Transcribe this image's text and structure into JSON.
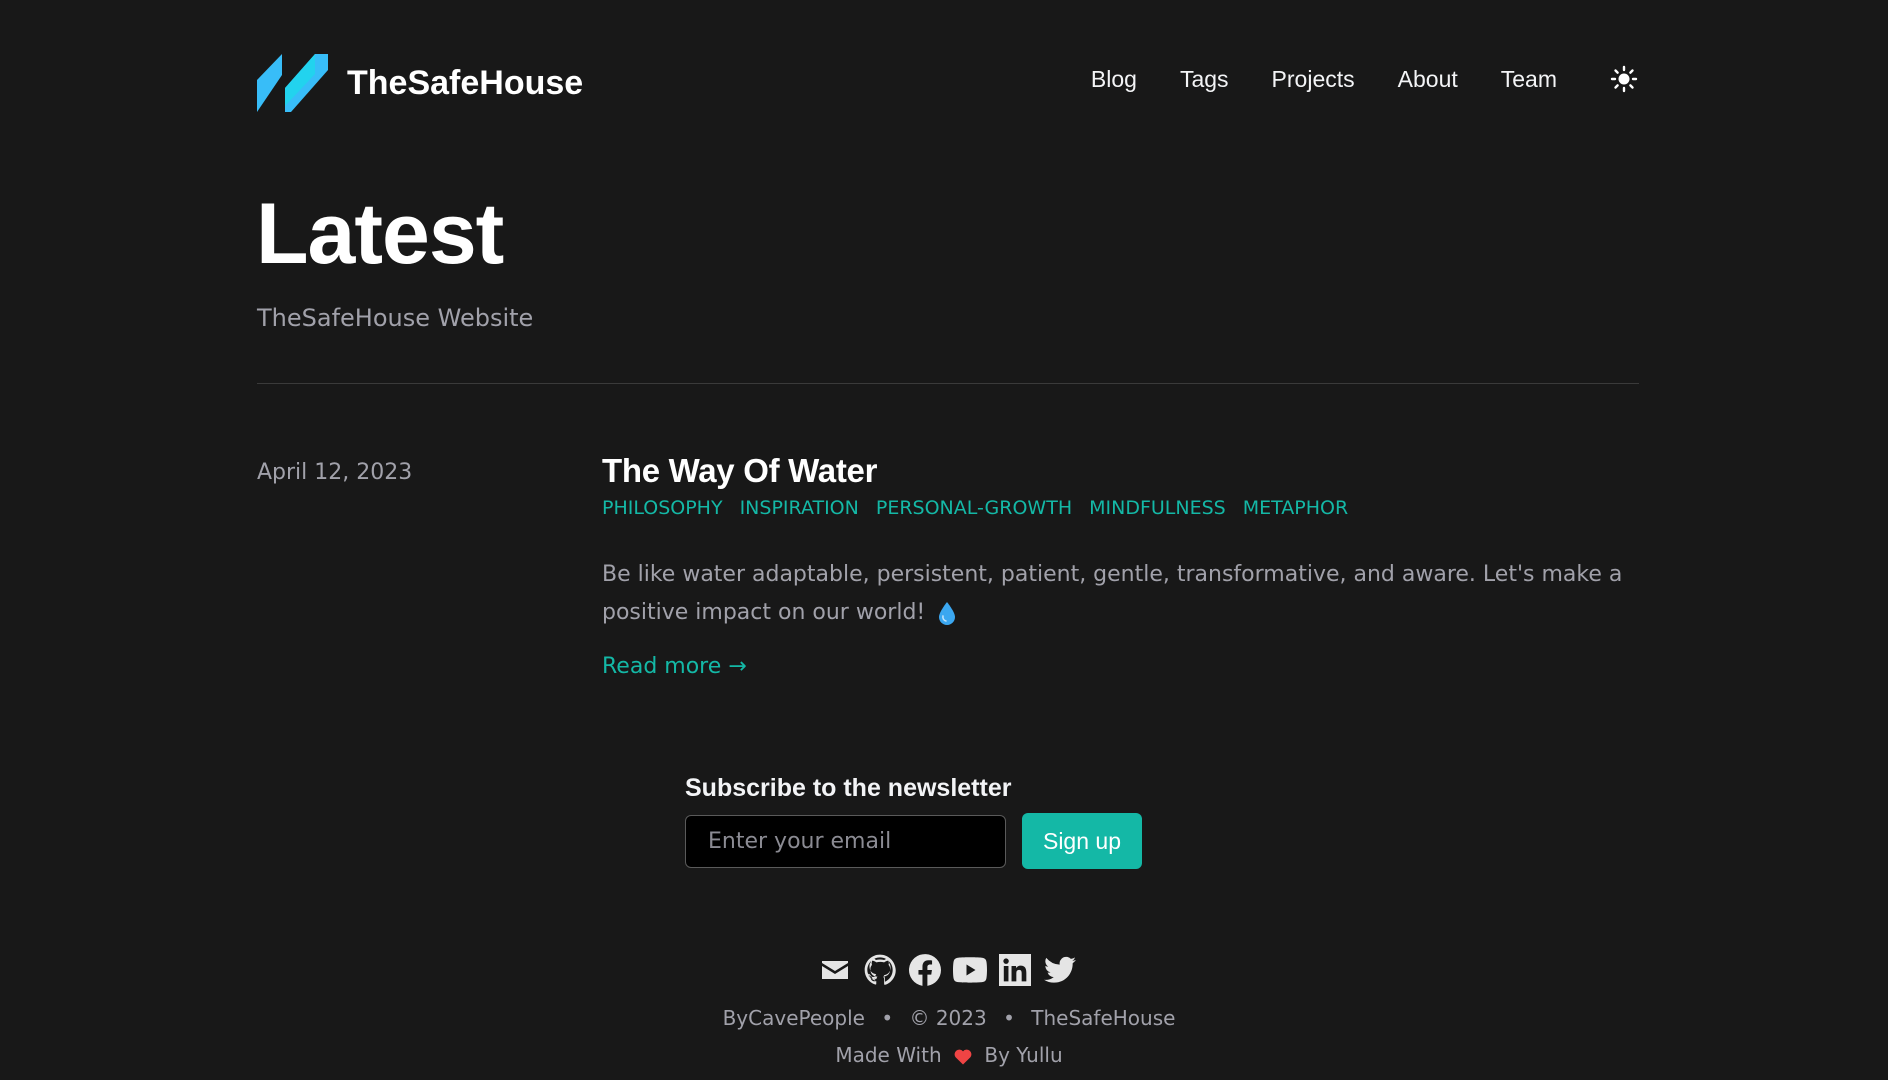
{
  "header": {
    "brand_name": "TheSafeHouse",
    "nav": [
      {
        "label": "Blog"
      },
      {
        "label": "Tags"
      },
      {
        "label": "Projects"
      },
      {
        "label": "About"
      },
      {
        "label": "Team"
      }
    ],
    "theme_toggle_icon": "sun-icon"
  },
  "hero": {
    "title": "Latest",
    "subtitle": "TheSafeHouse Website"
  },
  "post": {
    "date": "April 12, 2023",
    "title": "The Way Of Water",
    "tags": [
      "PHILOSOPHY",
      "INSPIRATION",
      "PERSONAL-GROWTH",
      "MINDFULNESS",
      "METAPHOR"
    ],
    "summary": "Be like water adaptable, persistent, patient, gentle, transformative, and aware. Let's make a positive impact on our world!",
    "summary_icon": "water-drop-icon",
    "read_more": "Read more →"
  },
  "newsletter": {
    "title": "Subscribe to the newsletter",
    "email_placeholder": "Enter your email",
    "email_value": "",
    "button_label": "Sign up"
  },
  "footer": {
    "social_icons": [
      "mail-icon",
      "github-icon",
      "facebook-icon",
      "youtube-icon",
      "linkedin-icon",
      "twitter-icon"
    ],
    "author": "ByCavePeople",
    "separator": "•",
    "copyright": "© 2023",
    "site": "TheSafeHouse",
    "made_with": "Made With",
    "by": "By Yullu"
  },
  "colors": {
    "background": "#181818",
    "accent": "#14b8a6",
    "logo": "#38bdf8",
    "heart": "#ef4444"
  }
}
